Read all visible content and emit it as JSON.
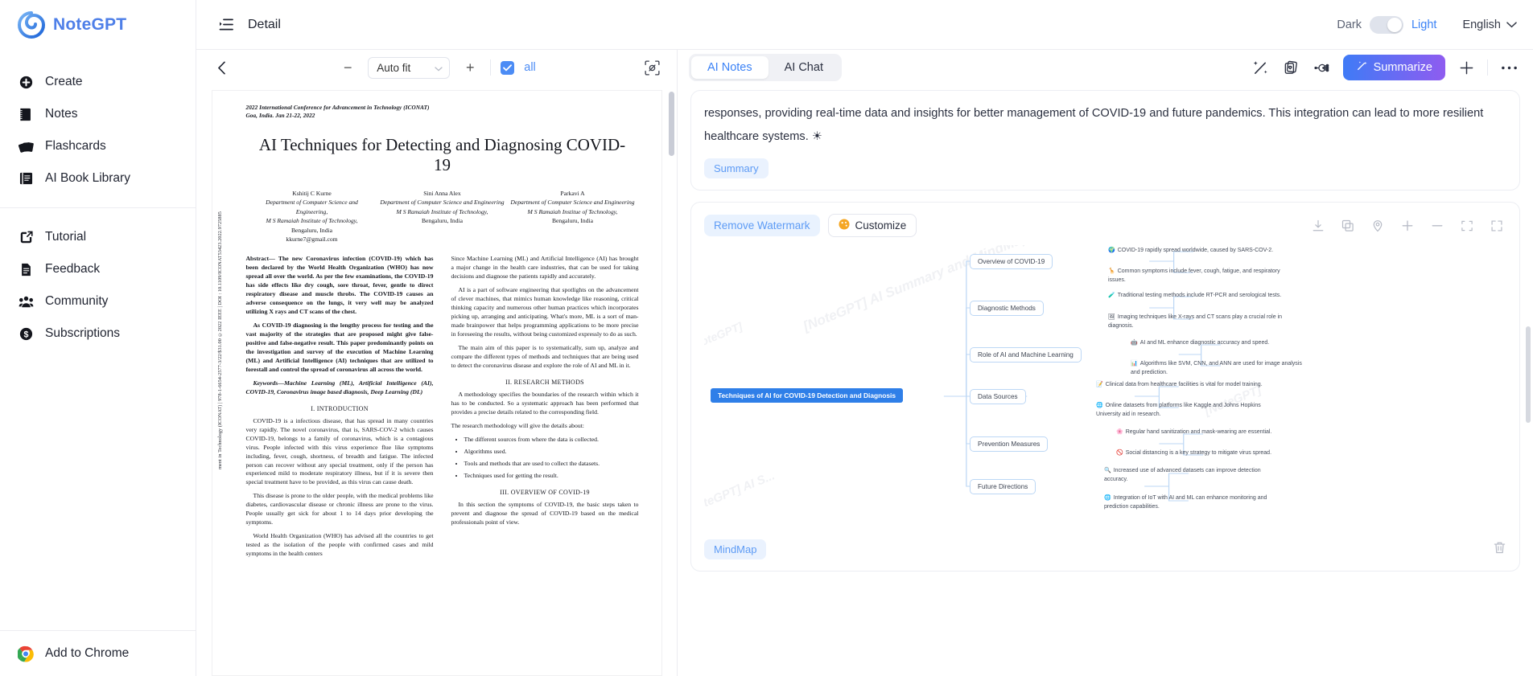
{
  "brand": {
    "name": "NoteGPT"
  },
  "sidebar": {
    "items": [
      {
        "label": "Create",
        "icon": "plus-circle-icon"
      },
      {
        "label": "Notes",
        "icon": "notebook-icon"
      },
      {
        "label": "Flashcards",
        "icon": "cards-icon"
      },
      {
        "label": "AI Book Library",
        "icon": "book-icon"
      }
    ],
    "items2": [
      {
        "label": "Tutorial",
        "icon": "external-link-icon"
      },
      {
        "label": "Feedback",
        "icon": "document-icon"
      },
      {
        "label": "Community",
        "icon": "people-icon"
      },
      {
        "label": "Subscriptions",
        "icon": "dollar-circle-icon"
      }
    ],
    "chrome": {
      "label": "Add to Chrome",
      "icon": "chrome-icon"
    }
  },
  "header": {
    "menu_icon": "list-indent-icon",
    "title": "Detail",
    "theme": {
      "dark_label": "Dark",
      "light_label": "Light",
      "active": "Light"
    },
    "language": {
      "value": "English",
      "chevron": "chevron-down-icon"
    }
  },
  "pdf_toolbar": {
    "back_icon": "chevron-left-icon",
    "zoom_out": "−",
    "zoom_value": "Auto fit",
    "zoom_in": "+",
    "checkbox_checked": true,
    "all_label": "all",
    "capture_icon": "screenshot-icon"
  },
  "pdf": {
    "conference_line1": "2022 International Conference for Advancement in Technology (ICONAT)",
    "conference_line2": "Goa, India. Jan 21-22, 2022",
    "title": "AI Techniques for Detecting and Diagnosing COVID-19",
    "spine": "ment in Technology (ICONAT) | 978-1-6654-2577-3/22/$31.00 ©2022 IEEE | DOI : 10.1109/ICONAT53423.2022.9725885",
    "authors": [
      {
        "name": "Kshitij C Kurne",
        "dept": "Department of Computer Science and Engineering,",
        "org": "M S Ramaiah Institute of Technology,",
        "city": "Bengaluru, India",
        "email": "kkurne7@gmail.com"
      },
      {
        "name": "Sini Anna Alex",
        "dept": "Department of Computer Science and Engineering",
        "org": "M S Ramaiah Institute of Technology,",
        "city": "Bengaluru, India",
        "email": ""
      },
      {
        "name": "Parkavi A",
        "dept": "Department of Computer Science and Engineering",
        "org": "M S Ramaiah Institue of Technology,",
        "city": "Bengaluru, India",
        "email": ""
      }
    ],
    "left_col": {
      "abstract": "Abstract— The new Coronavirus infection (COVID-19) which has been declared by the World Health Organization (WHO) has now spread all over the world. As per the few examinations, the COVID-19 has side effects like dry cough, sore throat, fever, gentle to direct respiratory disease and muscle throbs. The COVID-19 causes an adverse consequence on the lungs, it very well may be analyzed utilizing X rays and CT scans of the chest.",
      "para2": "As COVID-19 diagnosing is the lengthy process for testing and the vast majority of the strategies that are proposed might give false-positive and false-negative result. This paper predominantly points on the investigation and survey of the execution of Machine Learning (ML) and Artificial Intelligence (AI) techniques that are utilized to forestall and control the spread of coronavirus all across the world.",
      "keywords": "Keywords—Machine Learning (ML), Artificial Intelligence (AI), COVID-19, Coronavirus image based diagnosis, Deep Learning (DL)",
      "section": "I.     INTRODUCTION",
      "p1": "COVID-19 is a infectious disease, that has spread in many countries very rapidly. The novel coronavirus, that is, SARS-COV-2 which causes COVID-19, belongs to a family of coronavirus, which is a contagious virus. People infected with this virus experience flue like symptoms including, fever, cough, shortness, of breadth and fatigue. The infected person can recover without any special treatment, only if the person has experienced mild to moderate respiratory illness, but if it is severe then special treatment have to be provided, as this virus can cause death.",
      "p2": "This disease is prone to the older people, with the medical problems like diabetes, cardiovascular disease or chronic illness are prone to the virus. People usually get sick for about 1 to 14 days prior developing the symptoms.",
      "p3": "World Health Organization (WHO) has advised all the countries to get tested as the isolation of the people with confirmed cases and mild symptoms in the health centers"
    },
    "right_col": {
      "p1": "Since Machine Learning (ML) and Artificial Intelligence (AI) has brought a major change in the health care industries, that can be used for taking decisions and diagnose the patients rapidly and accurately.",
      "p2": "AI is a part of software engineering that spotlights on the advancement of clever machines, that mimics human knowledge like reasoning, critical thinking capacity and numerous other human practices which incorporates picking up, arranging and anticipating. What's more, ML is a sort of man-made brainpower that helps programming applications to be more precise in foreseeing the results, without being customized expressly to do as such.",
      "p3": "The main aim of this paper is to systematically, sum up, analyze and compare the different types of methods and techniques that are being used to detect the coronavirus disease and explore the role of AI and ML in it.",
      "section": "II.     RESEARCH METHODS",
      "p4": "A methodology specifies the boundaries of the research within which it has to be conducted. So a systematic approach has been performed that provides a precise details related to the corresponding field.",
      "p5": "The research methodology will give the details about:",
      "bullets": [
        "The different sources from where the data is collected.",
        "Algorithms used.",
        "Tools and methods that are used to collect the datasets.",
        "Techniques used for getting the result."
      ],
      "section2": "III.     OVERVIEW OF COVID-19",
      "p6": "In this section the symptoms of COVID-19, the basic steps taken to prevent and diagnose the spread of COVID-19 based on the medical professionals point of view."
    }
  },
  "ai_panel": {
    "tabs": [
      {
        "label": "AI Notes",
        "active": true
      },
      {
        "label": "AI Chat",
        "active": false
      }
    ],
    "icons": [
      {
        "name": "magic-wand-percent-icon"
      },
      {
        "name": "flashcard-stack-icon"
      },
      {
        "name": "mindmap-share-icon"
      }
    ],
    "summarize": {
      "label": "Summarize",
      "icon": "wand-icon"
    },
    "add_icon": "plus-icon",
    "more_icon": "more-horizontal-icon",
    "notes": {
      "text": "responses, providing real-time data and insights for better management of COVID-19 and future pandemics. This integration can lead to more resilient healthcare systems. ☀",
      "tag": "Summary"
    },
    "mindmap_card": {
      "remove_watermark": "Remove Watermark",
      "customize": "Customize",
      "customize_icon": "palette-icon",
      "tools": [
        {
          "name": "download-icon"
        },
        {
          "name": "copy-icon"
        },
        {
          "name": "pin-location-icon"
        },
        {
          "name": "zoom-in-icon"
        },
        {
          "name": "zoom-out-icon"
        },
        {
          "name": "fit-screen-icon"
        },
        {
          "name": "fullscreen-icon"
        }
      ],
      "watermarks": [
        "[NoteGPT] AI Summary and MindMap Generator",
        "[NoteGPT] AI Su...",
        "[NoteGPT]",
        "[NoteGPT] AI S..."
      ],
      "footer_tag": "MindMap",
      "delete_icon": "trash-icon"
    }
  },
  "mindmap": {
    "root": "Techniques of AI for COVID-19 Detection and Diagnosis",
    "branches": [
      {
        "title": "Overview of COVID-19",
        "leaves": [
          {
            "emoji": "🌍",
            "text": "COVID-19 rapidly spread worldwide, caused by SARS-COV-2."
          },
          {
            "emoji": "🦒",
            "text": "Common symptoms include fever, cough, fatigue, and respiratory issues."
          }
        ]
      },
      {
        "title": "Diagnostic Methods",
        "leaves": [
          {
            "emoji": "🧪",
            "text": "Traditional testing methods include RT-PCR and serological tests."
          },
          {
            "emoji": "🖼",
            "text": "Imaging techniques like X-rays and CT scans play a crucial role in diagnosis."
          }
        ]
      },
      {
        "title": "Role of AI and Machine Learning",
        "leaves": [
          {
            "emoji": "🤖",
            "text": "AI and ML enhance diagnostic accuracy and speed."
          },
          {
            "emoji": "📊",
            "text": "Algorithms like SVM, CNN, and ANN are used for image analysis and prediction."
          }
        ]
      },
      {
        "title": "Data Sources",
        "leaves": [
          {
            "emoji": "📝",
            "text": "Clinical data from healthcare facilities is vital for model training."
          },
          {
            "emoji": "🌐",
            "text": "Online datasets from platforms like Kaggle and Johns Hopkins University aid in research."
          }
        ]
      },
      {
        "title": "Prevention Measures",
        "leaves": [
          {
            "emoji": "🌸",
            "text": "Regular hand sanitization and mask-wearing are essential."
          },
          {
            "emoji": "🚫",
            "text": "Social distancing is a key strategy to mitigate virus spread."
          }
        ]
      },
      {
        "title": "Future Directions",
        "leaves": [
          {
            "emoji": "🔍",
            "text": "Increased use of advanced datasets can improve detection accuracy."
          },
          {
            "emoji": "🌐",
            "text": "Integration of IoT with AI and ML can enhance monitoring and prediction capabilities."
          }
        ]
      }
    ]
  },
  "colors": {
    "brand_blue": "#4e7fe8",
    "accent_blue": "#3b82f6",
    "summarize_from": "#3f7bf6",
    "summarize_to": "#8f5cf0",
    "mm_root_bg": "#2f7fe8"
  }
}
